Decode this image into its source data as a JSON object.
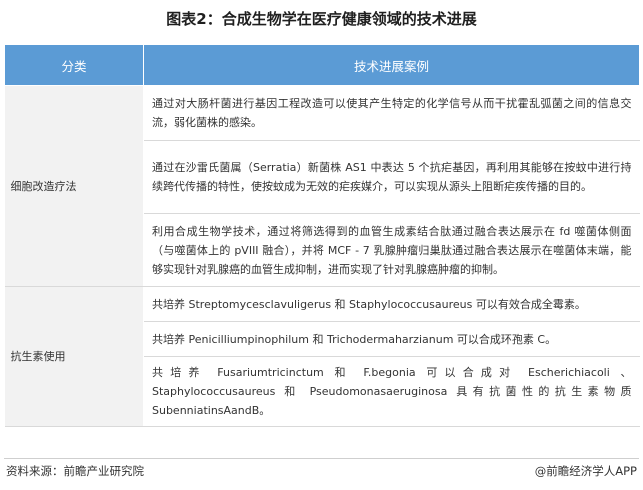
{
  "title": "图表2：合成生物学在医疗健康领域的技术进展",
  "table": {
    "headers": [
      "分类",
      "技术进展案例"
    ],
    "categories": [
      "细胞改造疗法",
      "抗生素使用"
    ],
    "rows": [
      "通过对大肠杆菌进行基因工程改造可以使其产生特定的化学信号从而干扰霍乱弧菌之间的信息交流，弱化菌株的感染。",
      "通过在沙雷氏菌属（Serratia）新菌株 AS1 中表达 5 个抗疟基因，再利用其能够在按蚊中进行持续跨代传播的特性，使按蚊成为无效的疟疾媒介，可以实现从源头上阻断疟疾传播的目的。",
      "利用合成生物学技术，通过将筛选得到的血管生成素结合肽通过融合表达展示在 fd 噬菌体侧面（与噬菌体上的 pVIII 融合），并将 MCF - 7 乳腺肿瘤归巢肽通过融合表达展示在噬菌体末端，能够实现针对乳腺癌的血管生成抑制，进而实现了针对乳腺癌肿瘤的抑制。",
      "共培养 Streptomycesclavuligerus 和 Staphylococcusaureus 可以有效合成全霉素。",
      "共培养 Penicilliumpinophilum 和 Trichodermaharzianum 可以合成环孢素 C。",
      "共培养 Fusariumtricinctum 和 F.begonia 可以合成对 Escherichiacoli 、Staphylococcusaureus 和 Pseudomonasaeruginosa 具有抗菌性的抗生素物质 SubenniatinsAandB。"
    ]
  },
  "footer": {
    "source": "资料来源：前瞻产业研究院",
    "brand": "@前瞻经济学人APP"
  }
}
